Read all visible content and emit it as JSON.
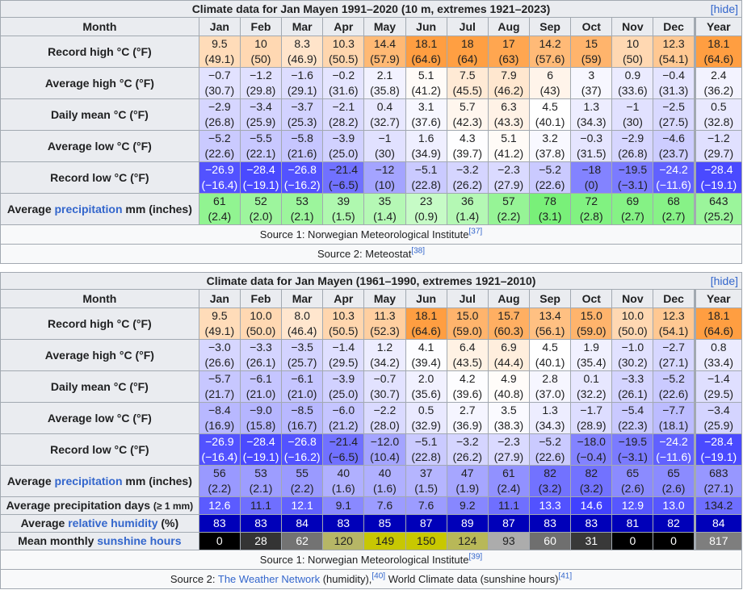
{
  "tables": [
    {
      "title": "Climate data for Jan Mayen 1991–2020 (10 m, extremes 1921–2023)",
      "hide": "hide",
      "month_header": "Month",
      "months": [
        "Jan",
        "Feb",
        "Mar",
        "Apr",
        "May",
        "Jun",
        "Jul",
        "Aug",
        "Sep",
        "Oct",
        "Nov",
        "Dec"
      ],
      "year_header": "Year",
      "rows": [
        {
          "label_pre": "Record high °C (°F)",
          "scale": "temp",
          "values": [
            [
              "9.5",
              "(49.1)"
            ],
            [
              "10",
              "(50)"
            ],
            [
              "8.3",
              "(46.9)"
            ],
            [
              "10.3",
              "(50.5)"
            ],
            [
              "14.4",
              "(57.9)"
            ],
            [
              "18.1",
              "(64.6)"
            ],
            [
              "18",
              "(64)"
            ],
            [
              "17",
              "(63)"
            ],
            [
              "14.2",
              "(57.6)"
            ],
            [
              "15",
              "(59)"
            ],
            [
              "10",
              "(50)"
            ],
            [
              "12.3",
              "(54.1)"
            ],
            [
              "18.1",
              "(64.6)"
            ]
          ]
        },
        {
          "label_pre": "Average high °C (°F)",
          "scale": "temp",
          "values": [
            [
              "−0.7",
              "(30.7)"
            ],
            [
              "−1.2",
              "(29.8)"
            ],
            [
              "−1.6",
              "(29.1)"
            ],
            [
              "−0.2",
              "(31.6)"
            ],
            [
              "2.1",
              "(35.8)"
            ],
            [
              "5.1",
              "(41.2)"
            ],
            [
              "7.5",
              "(45.5)"
            ],
            [
              "7.9",
              "(46.2)"
            ],
            [
              "6",
              "(43)"
            ],
            [
              "3",
              "(37)"
            ],
            [
              "0.9",
              "(33.6)"
            ],
            [
              "−0.4",
              "(31.3)"
            ],
            [
              "2.4",
              "(36.2)"
            ]
          ]
        },
        {
          "label_pre": "Daily mean °C (°F)",
          "scale": "temp",
          "values": [
            [
              "−2.9",
              "(26.8)"
            ],
            [
              "−3.4",
              "(25.9)"
            ],
            [
              "−3.7",
              "(25.3)"
            ],
            [
              "−2.1",
              "(28.2)"
            ],
            [
              "0.4",
              "(32.7)"
            ],
            [
              "3.1",
              "(37.6)"
            ],
            [
              "5.7",
              "(42.3)"
            ],
            [
              "6.3",
              "(43.3)"
            ],
            [
              "4.5",
              "(40.1)"
            ],
            [
              "1.3",
              "(34.3)"
            ],
            [
              "−1",
              "(30)"
            ],
            [
              "−2.5",
              "(27.5)"
            ],
            [
              "0.5",
              "(32.8)"
            ]
          ]
        },
        {
          "label_pre": "Average low °C (°F)",
          "scale": "temp",
          "values": [
            [
              "−5.2",
              "(22.6)"
            ],
            [
              "−5.5",
              "(22.1)"
            ],
            [
              "−5.8",
              "(21.6)"
            ],
            [
              "−3.9",
              "(25.0)"
            ],
            [
              "−1",
              "(30)"
            ],
            [
              "1.6",
              "(34.9)"
            ],
            [
              "4.3",
              "(39.7)"
            ],
            [
              "5.1",
              "(41.2)"
            ],
            [
              "3.2",
              "(37.8)"
            ],
            [
              "−0.3",
              "(31.5)"
            ],
            [
              "−2.9",
              "(26.8)"
            ],
            [
              "−4.6",
              "(23.7)"
            ],
            [
              "−1.2",
              "(29.7)"
            ]
          ]
        },
        {
          "label_pre": "Record low °C (°F)",
          "scale": "temp",
          "values": [
            [
              "−26.9",
              "(−16.4)"
            ],
            [
              "−28.4",
              "(−19.1)"
            ],
            [
              "−26.8",
              "(−16.2)"
            ],
            [
              "−21.4",
              "(−6.5)"
            ],
            [
              "−12",
              "(10)"
            ],
            [
              "−5.1",
              "(22.8)"
            ],
            [
              "−3.2",
              "(26.2)"
            ],
            [
              "−2.3",
              "(27.9)"
            ],
            [
              "−5.2",
              "(22.6)"
            ],
            [
              "−18",
              "(0)"
            ],
            [
              "−19.5",
              "(−3.1)"
            ],
            [
              "−24.2",
              "(−11.6)"
            ],
            [
              "−28.4",
              "(−19.1)"
            ]
          ]
        },
        {
          "label_pre": "Average ",
          "label_link": "precipitation",
          "label_post": " mm (inches)",
          "scale": "precip-green",
          "year_sum": true,
          "values": [
            [
              "61",
              "(2.4)"
            ],
            [
              "52",
              "(2.0)"
            ],
            [
              "53",
              "(2.1)"
            ],
            [
              "39",
              "(1.5)"
            ],
            [
              "35",
              "(1.4)"
            ],
            [
              "23",
              "(0.9)"
            ],
            [
              "36",
              "(1.4)"
            ],
            [
              "57",
              "(2.2)"
            ],
            [
              "78",
              "(3.1)"
            ],
            [
              "72",
              "(2.8)"
            ],
            [
              "69",
              "(2.7)"
            ],
            [
              "68",
              "(2.7)"
            ],
            [
              "643",
              "(25.2)"
            ]
          ]
        }
      ],
      "sources": [
        {
          "text": "Source 1: Norwegian Meteorological Institute",
          "ref": "[37]"
        },
        {
          "text": "Source 2: Meteostat",
          "ref": "[38]"
        }
      ]
    },
    {
      "title": "Climate data for Jan Mayen (1961–1990, extremes 1921–2010)",
      "hide": "hide",
      "month_header": "Month",
      "months": [
        "Jan",
        "Feb",
        "Mar",
        "Apr",
        "May",
        "Jun",
        "Jul",
        "Aug",
        "Sep",
        "Oct",
        "Nov",
        "Dec"
      ],
      "year_header": "Year",
      "rows": [
        {
          "label_pre": "Record high °C (°F)",
          "scale": "temp",
          "values": [
            [
              "9.5",
              "(49.1)"
            ],
            [
              "10.0",
              "(50.0)"
            ],
            [
              "8.0",
              "(46.4)"
            ],
            [
              "10.3",
              "(50.5)"
            ],
            [
              "11.3",
              "(52.3)"
            ],
            [
              "18.1",
              "(64.6)"
            ],
            [
              "15.0",
              "(59.0)"
            ],
            [
              "15.7",
              "(60.3)"
            ],
            [
              "13.4",
              "(56.1)"
            ],
            [
              "15.0",
              "(59.0)"
            ],
            [
              "10.0",
              "(50.0)"
            ],
            [
              "12.3",
              "(54.1)"
            ],
            [
              "18.1",
              "(64.6)"
            ]
          ]
        },
        {
          "label_pre": "Average high °C (°F)",
          "scale": "temp",
          "values": [
            [
              "−3.0",
              "(26.6)"
            ],
            [
              "−3.3",
              "(26.1)"
            ],
            [
              "−3.5",
              "(25.7)"
            ],
            [
              "−1.4",
              "(29.5)"
            ],
            [
              "1.2",
              "(34.2)"
            ],
            [
              "4.1",
              "(39.4)"
            ],
            [
              "6.4",
              "(43.5)"
            ],
            [
              "6.9",
              "(44.4)"
            ],
            [
              "4.5",
              "(40.1)"
            ],
            [
              "1.9",
              "(35.4)"
            ],
            [
              "−1.0",
              "(30.2)"
            ],
            [
              "−2.7",
              "(27.1)"
            ],
            [
              "0.8",
              "(33.4)"
            ]
          ]
        },
        {
          "label_pre": "Daily mean °C (°F)",
          "scale": "temp",
          "values": [
            [
              "−5.7",
              "(21.7)"
            ],
            [
              "−6.1",
              "(21.0)"
            ],
            [
              "−6.1",
              "(21.0)"
            ],
            [
              "−3.9",
              "(25.0)"
            ],
            [
              "−0.7",
              "(30.7)"
            ],
            [
              "2.0",
              "(35.6)"
            ],
            [
              "4.2",
              "(39.6)"
            ],
            [
              "4.9",
              "(40.8)"
            ],
            [
              "2.8",
              "(37.0)"
            ],
            [
              "0.1",
              "(32.2)"
            ],
            [
              "−3.3",
              "(26.1)"
            ],
            [
              "−5.2",
              "(22.6)"
            ],
            [
              "−1.4",
              "(29.5)"
            ]
          ]
        },
        {
          "label_pre": "Average low °C (°F)",
          "scale": "temp",
          "values": [
            [
              "−8.4",
              "(16.9)"
            ],
            [
              "−9.0",
              "(15.8)"
            ],
            [
              "−8.5",
              "(16.7)"
            ],
            [
              "−6.0",
              "(21.2)"
            ],
            [
              "−2.2",
              "(28.0)"
            ],
            [
              "0.5",
              "(32.9)"
            ],
            [
              "2.7",
              "(36.9)"
            ],
            [
              "3.5",
              "(38.3)"
            ],
            [
              "1.3",
              "(34.3)"
            ],
            [
              "−1.7",
              "(28.9)"
            ],
            [
              "−5.4",
              "(22.3)"
            ],
            [
              "−7.7",
              "(18.1)"
            ],
            [
              "−3.4",
              "(25.9)"
            ]
          ]
        },
        {
          "label_pre": "Record low °C (°F)",
          "scale": "temp",
          "values": [
            [
              "−26.9",
              "(−16.4)"
            ],
            [
              "−28.4",
              "(−19.1)"
            ],
            [
              "−26.8",
              "(−16.2)"
            ],
            [
              "−21.4",
              "(−6.5)"
            ],
            [
              "−12.0",
              "(10.4)"
            ],
            [
              "−5.1",
              "(22.8)"
            ],
            [
              "−3.2",
              "(26.2)"
            ],
            [
              "−2.3",
              "(27.9)"
            ],
            [
              "−5.2",
              "(22.6)"
            ],
            [
              "−18.0",
              "(−0.4)"
            ],
            [
              "−19.5",
              "(−3.1)"
            ],
            [
              "−24.2",
              "(−11.6)"
            ],
            [
              "−28.4",
              "(−19.1)"
            ]
          ]
        },
        {
          "label_pre": "Average ",
          "label_link": "precipitation",
          "label_post": " mm (inches)",
          "scale": "precip-blue",
          "year_sum": true,
          "values": [
            [
              "56",
              "(2.2)"
            ],
            [
              "53",
              "(2.1)"
            ],
            [
              "55",
              "(2.2)"
            ],
            [
              "40",
              "(1.6)"
            ],
            [
              "40",
              "(1.6)"
            ],
            [
              "37",
              "(1.5)"
            ],
            [
              "47",
              "(1.9)"
            ],
            [
              "61",
              "(2.4)"
            ],
            [
              "82",
              "(3.2)"
            ],
            [
              "82",
              "(3.2)"
            ],
            [
              "65",
              "(2.6)"
            ],
            [
              "65",
              "(2.6)"
            ],
            [
              "683",
              "(27.1)"
            ]
          ]
        },
        {
          "label_pre": "Average precipitation days ",
          "label_small": "(≥ 1 mm)",
          "scale": "days",
          "year_sum": true,
          "short": true,
          "values": [
            [
              "12.6"
            ],
            [
              "11.1"
            ],
            [
              "12.1"
            ],
            [
              "9.1"
            ],
            [
              "7.6"
            ],
            [
              "7.6"
            ],
            [
              "9.2"
            ],
            [
              "11.1"
            ],
            [
              "13.3"
            ],
            [
              "14.6"
            ],
            [
              "12.9"
            ],
            [
              "13.0"
            ],
            [
              "134.2"
            ]
          ]
        },
        {
          "label_pre": "Average ",
          "label_link": "relative humidity",
          "label_post": " (%)",
          "scale": "humidity",
          "short": true,
          "values": [
            [
              "83"
            ],
            [
              "83"
            ],
            [
              "84"
            ],
            [
              "83"
            ],
            [
              "85"
            ],
            [
              "87"
            ],
            [
              "89"
            ],
            [
              "87"
            ],
            [
              "83"
            ],
            [
              "83"
            ],
            [
              "81"
            ],
            [
              "82"
            ],
            [
              "84"
            ]
          ]
        },
        {
          "label_pre": "Mean monthly ",
          "label_link": "sunshine hours",
          "label_post": "",
          "scale": "sun",
          "year_sum": true,
          "short": true,
          "values": [
            [
              "0"
            ],
            [
              "28"
            ],
            [
              "62"
            ],
            [
              "120"
            ],
            [
              "149"
            ],
            [
              "150"
            ],
            [
              "124"
            ],
            [
              "93"
            ],
            [
              "60"
            ],
            [
              "31"
            ],
            [
              "0"
            ],
            [
              "0"
            ],
            [
              "817"
            ]
          ]
        }
      ],
      "sources": [
        {
          "text": "Source 1: Norwegian Meteorological Institute",
          "ref": "[39]"
        },
        {
          "text": "Source 2: ",
          "link": "The Weather Network",
          "text2": " (humidity),",
          "ref": "[40]",
          "text3": " World Climate data (sunshine hours)",
          "ref2": "[41]"
        }
      ]
    }
  ],
  "colors": {
    "header_bg": "#eaecf0",
    "border": "#a2a9b1",
    "link": "#3366cc"
  }
}
